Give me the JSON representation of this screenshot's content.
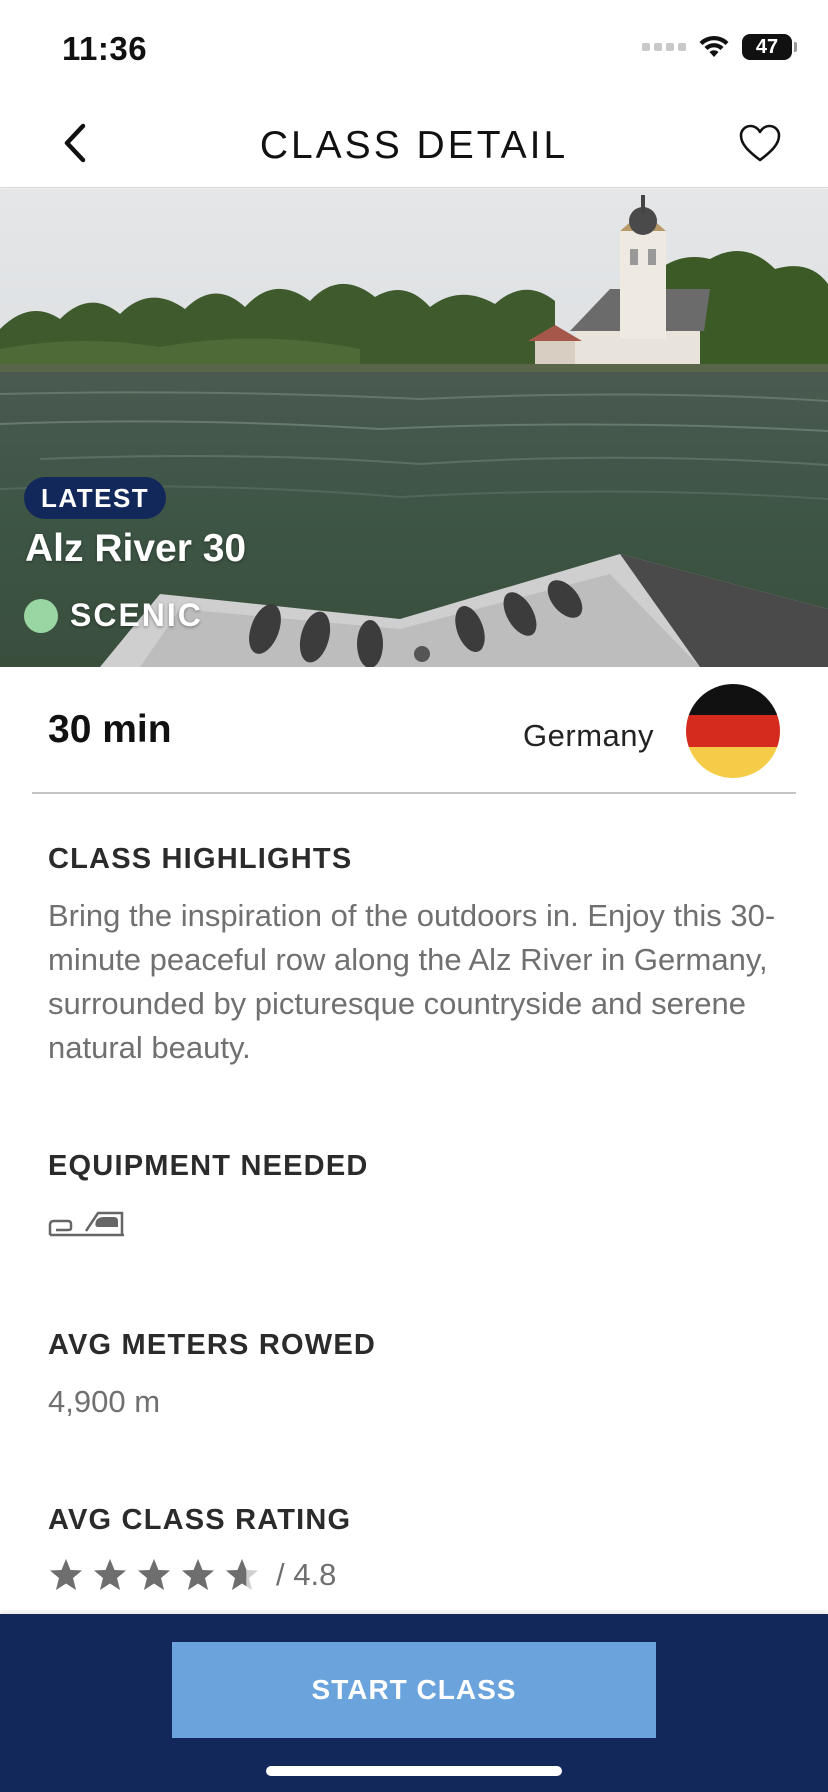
{
  "status_bar": {
    "time": "11:36",
    "battery": "47"
  },
  "header": {
    "title": "CLASS DETAIL",
    "back_icon": "chevron-left-icon",
    "favorite_icon": "heart-outline-icon"
  },
  "hero": {
    "badge": "LATEST",
    "title": "Alz River 30",
    "tag": "SCENIC",
    "tag_color": "#99d6a4"
  },
  "info": {
    "duration": "30 min",
    "country": "Germany",
    "flag_colors": [
      "#111111",
      "#d52b1e",
      "#f5cc47"
    ]
  },
  "highlights": {
    "title": "CLASS HIGHLIGHTS",
    "body": "Bring the inspiration of the outdoors in. Enjoy this 30-minute peaceful row along the Alz River in Germany, surrounded by picturesque countryside and serene natural beauty."
  },
  "equipment": {
    "title": "EQUIPMENT NEEDED",
    "icon": "rowing-machine-icon"
  },
  "meters": {
    "title": "AVG METERS ROWED",
    "value": "4,900 m"
  },
  "rating": {
    "title": "AVG CLASS RATING",
    "value_label": "/ 4.8",
    "rating": 4.8,
    "max": 5
  },
  "footer": {
    "start_label": "START CLASS"
  },
  "colors": {
    "navy": "#13285a",
    "button_blue": "#6ba3dc",
    "muted_text": "#707070"
  }
}
